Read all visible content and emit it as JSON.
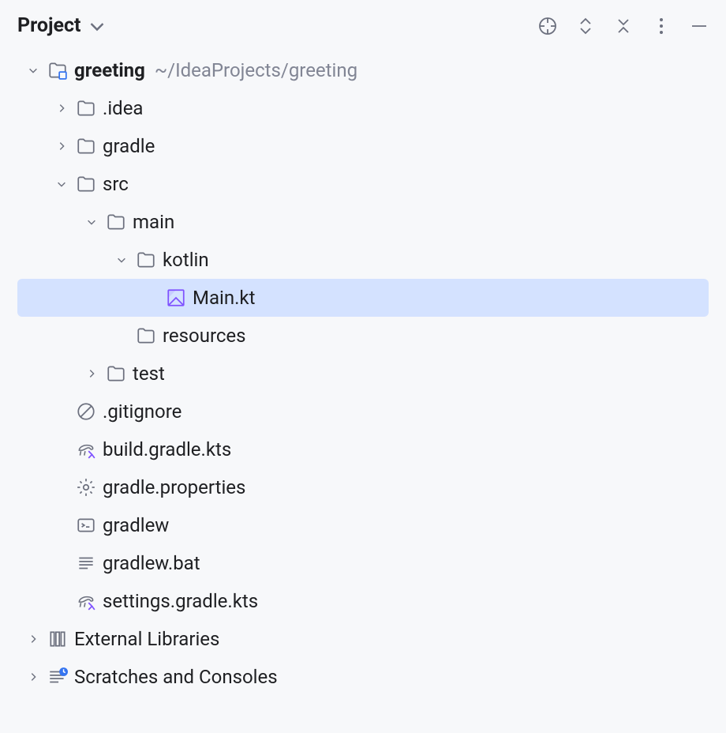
{
  "header": {
    "title": "Project"
  },
  "tree": {
    "root": {
      "name": "greeting",
      "path": "~/IdeaProjects/greeting"
    },
    "idea": ".idea",
    "gradle": "gradle",
    "src": "src",
    "main": "main",
    "kotlin": "kotlin",
    "main_kt": "Main.kt",
    "resources": "resources",
    "test": "test",
    "gitignore": ".gitignore",
    "build_gradle": "build.gradle.kts",
    "gradle_properties": "gradle.properties",
    "gradlew": "gradlew",
    "gradlew_bat": "gradlew.bat",
    "settings_gradle": "settings.gradle.kts",
    "external_libraries": "External Libraries",
    "scratches": "Scratches and Consoles"
  }
}
